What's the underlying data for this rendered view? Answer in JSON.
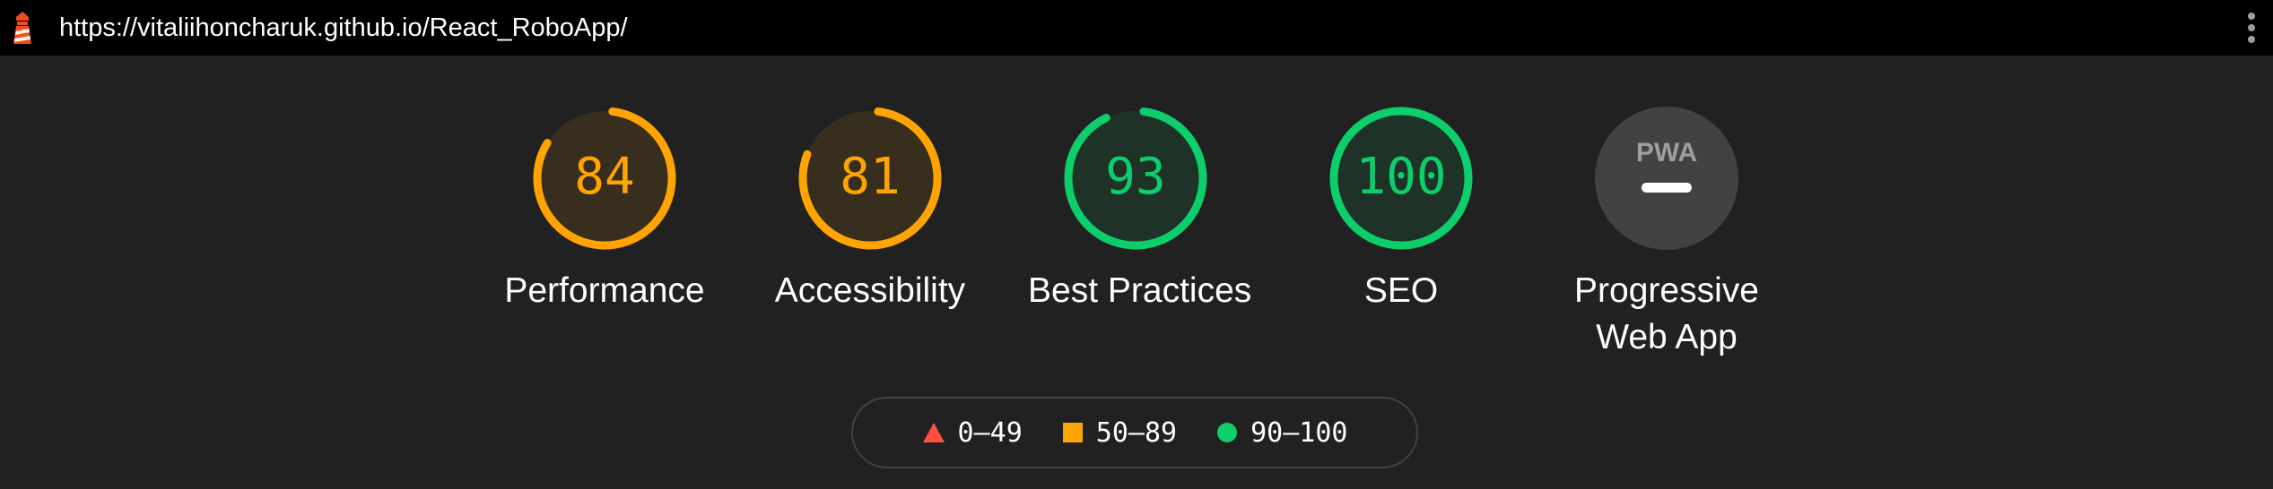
{
  "address_bar": {
    "url": "https://vitaliihoncharuk.github.io/React_RoboApp/",
    "logo_icon": "lighthouse-icon",
    "menu_icon": "more-vertical-icon"
  },
  "colors": {
    "average": "#ffa400",
    "pass": "#0cce6b",
    "fail": "#ff4e42",
    "pwa_badge_bg": "#424242"
  },
  "gauges": [
    {
      "label": "Performance",
      "score": "84",
      "fraction": 0.84,
      "rating": "average"
    },
    {
      "label": "Accessibility",
      "score": "81",
      "fraction": 0.81,
      "rating": "average"
    },
    {
      "label": "Best Practices",
      "score": "93",
      "fraction": 0.93,
      "rating": "pass"
    },
    {
      "label": "SEO",
      "score": "100",
      "fraction": 1.0,
      "rating": "pass"
    }
  ],
  "pwa": {
    "badge_text": "PWA",
    "label": "Progressive Web App",
    "icon": "pwa-badge-icon"
  },
  "legend": {
    "fail": {
      "range": "0–49",
      "icon": "triangle-icon"
    },
    "average": {
      "range": "50–89",
      "icon": "square-icon"
    },
    "pass": {
      "range": "90–100",
      "icon": "circle-icon"
    }
  }
}
